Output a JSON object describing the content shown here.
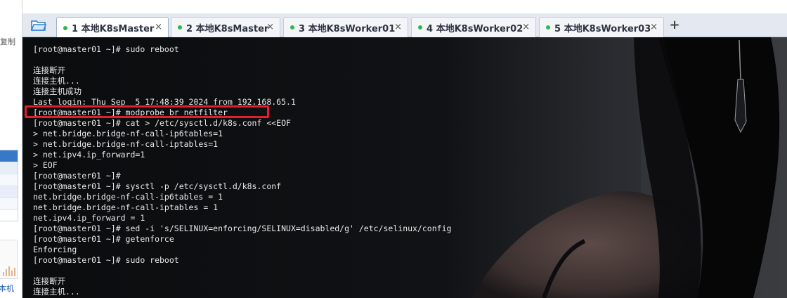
{
  "left_panel": {
    "copy_label": "复制",
    "host_label": "本机"
  },
  "tabs": [
    {
      "label": "1 本地K8sMaster",
      "active": true,
      "status_color": "#2fb84a"
    },
    {
      "label": "2 本地K8sMaster",
      "active": false,
      "status_color": "#2fb84a"
    },
    {
      "label": "3 本地K8sWorker01",
      "active": false,
      "status_color": "#2fb84a"
    },
    {
      "label": "4 本地K8sWorker02",
      "active": false,
      "status_color": "#2fb84a"
    },
    {
      "label": "5 本地K8sWorker03",
      "active": false,
      "status_color": "#2fb84a"
    }
  ],
  "tab_icons": {
    "close": "×",
    "new_tab": "+"
  },
  "terminal": {
    "lines": [
      "[root@master01 ~]# sudo reboot",
      "",
      "连接断开",
      "连接主机...",
      "连接主机成功",
      "Last login: Thu Sep  5 17:48:39 2024 from 192.168.65.1",
      "[root@master01 ~]# modprobe br_netfilter",
      "[root@master01 ~]# cat > /etc/sysctl.d/k8s.conf <<EOF",
      "> net.bridge.bridge-nf-call-ip6tables=1",
      "> net.bridge.bridge-nf-call-iptables=1",
      "> net.ipv4.ip_forward=1",
      "> EOF",
      "[root@master01 ~]#",
      "[root@master01 ~]# sysctl -p /etc/sysctl.d/k8s.conf",
      "net.bridge.bridge-nf-call-ip6tables = 1",
      "net.bridge.bridge-nf-call-iptables = 1",
      "net.ipv4.ip_forward = 1",
      "[root@master01 ~]# sed -i 's/SELINUX=enforcing/SELINUX=disabled/g' /etc/selinux/config",
      "[root@master01 ~]# getenforce",
      "Enforcing",
      "[root@master01 ~]# sudo reboot",
      "",
      "连接断开",
      "连接主机..."
    ],
    "highlighted_line": 6
  },
  "colors": {
    "terminal_bg": "#0c0d0f",
    "terminal_text": "#e8e8e8",
    "highlight": "#e0202a",
    "tab_status": "#2fb84a"
  }
}
